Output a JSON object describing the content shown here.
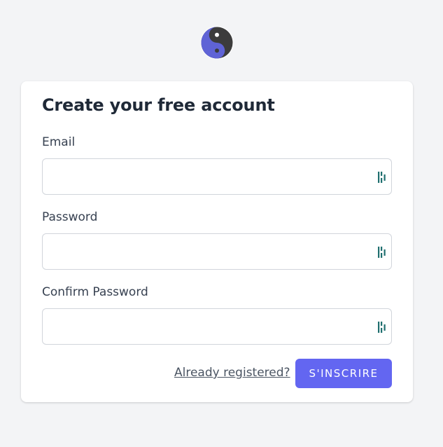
{
  "logo": {
    "icon": "yin-yang-icon",
    "colors": {
      "light": "#5f63d6",
      "dark": "#3c3c3c"
    }
  },
  "form": {
    "title": "Create your free account",
    "fields": [
      {
        "label": "Email",
        "value": "",
        "placeholder": "",
        "type": "email"
      },
      {
        "label": "Password",
        "value": "",
        "placeholder": "",
        "type": "password"
      },
      {
        "label": "Confirm Password",
        "value": "",
        "placeholder": "",
        "type": "password"
      }
    ],
    "field_icon": "password-manager-icon",
    "already_registered_link": "Already registered?",
    "submit_label": "S'INSCRIRE"
  },
  "colors": {
    "background": "#f3f4f6",
    "accent": "#6366f1",
    "field_icon": "#1f6f6f"
  }
}
